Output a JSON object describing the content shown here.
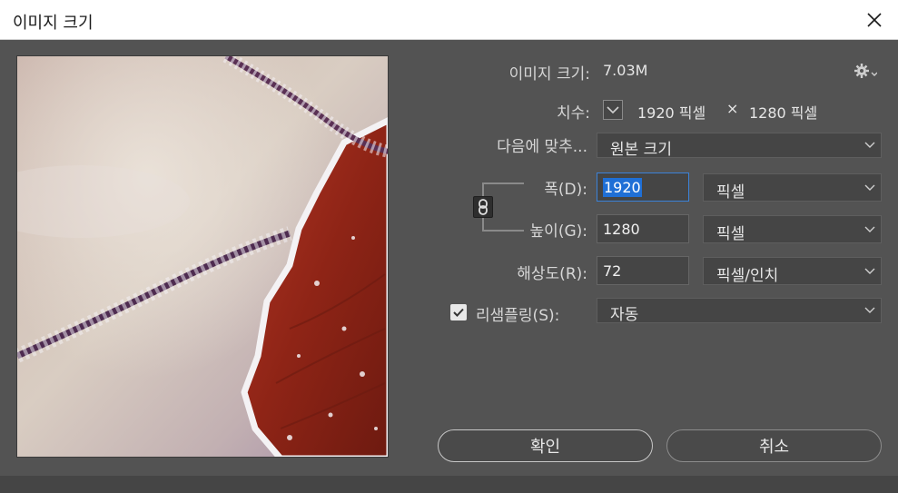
{
  "window": {
    "title": "이미지 크기",
    "close_icon": "close-icon"
  },
  "info": {
    "image_size_label": "이미지 크기:",
    "image_size_value": "7.03M",
    "dimensions_label": "치수:",
    "dim_width": "1920 픽셀",
    "dim_times": "×",
    "dim_height": "1280 픽셀"
  },
  "fit_to": {
    "label": "다음에 맞추...",
    "value": "원본 크기"
  },
  "width": {
    "label": "폭(D):",
    "value": "1920",
    "unit": "픽셀"
  },
  "height": {
    "label": "높이(G):",
    "value": "1280",
    "unit": "픽셀"
  },
  "resolution": {
    "label": "해상도(R):",
    "value": "72",
    "unit": "픽셀/인치"
  },
  "resample": {
    "label": "리샘플링(S):",
    "checked": true,
    "value": "자동"
  },
  "buttons": {
    "ok": "확인",
    "cancel": "취소"
  },
  "colors": {
    "dialog_bg": "#535353",
    "field_bg": "#454545",
    "selection": "#1f6fd6"
  }
}
